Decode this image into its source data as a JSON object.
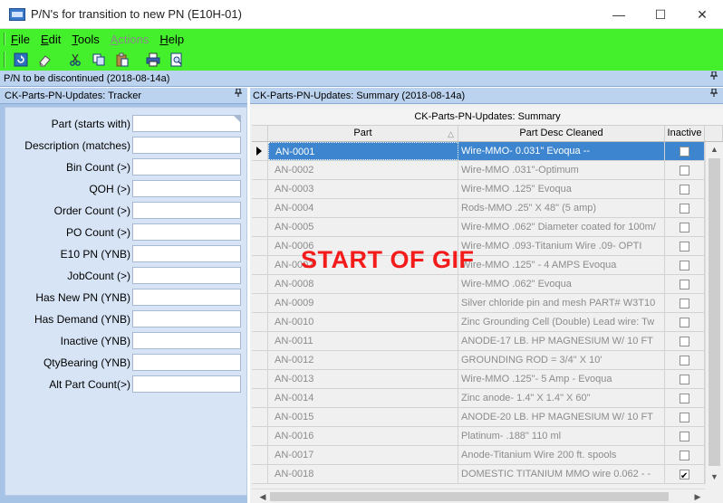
{
  "window": {
    "title": "P/N's for transition to new PN (E10H-01)",
    "minimize_glyph": "—",
    "maximize_glyph": "☐",
    "close_glyph": "✕"
  },
  "menu": {
    "file": {
      "accel": "F",
      "rest": "ile"
    },
    "edit": {
      "accel": "E",
      "rest": "dit"
    },
    "tools": {
      "accel": "T",
      "rest": "ools"
    },
    "actions": {
      "accel": "A",
      "rest": "ctions"
    },
    "help": {
      "accel": "H",
      "rest": "elp"
    }
  },
  "toolbar_icons": [
    "refresh-icon",
    "eraser-icon",
    "cut-icon",
    "copy-icon",
    "paste-icon",
    "print-icon",
    "print-preview-icon"
  ],
  "dock": {
    "top_title": "P/N to be discontinued (2018-08-14a)"
  },
  "tracker": {
    "title": "CK-Parts-PN-Updates: Tracker",
    "fields": [
      {
        "label": "Part (starts with)",
        "value": ""
      },
      {
        "label": "Description (matches)",
        "value": ""
      },
      {
        "label": "Bin Count (>)",
        "value": ""
      },
      {
        "label": "QOH (>)",
        "value": ""
      },
      {
        "label": "Order Count (>)",
        "value": ""
      },
      {
        "label": "PO Count (>)",
        "value": ""
      },
      {
        "label": "E10 PN (YNB)",
        "value": ""
      },
      {
        "label": "JobCount (>)",
        "value": ""
      },
      {
        "label": "Has New PN (YNB)",
        "value": ""
      },
      {
        "label": "Has Demand (YNB)",
        "value": ""
      },
      {
        "label": "Inactive (YNB)",
        "value": ""
      },
      {
        "label": "QtyBearing (YNB)",
        "value": ""
      },
      {
        "label": "Alt Part Count(>)",
        "value": ""
      }
    ]
  },
  "summary": {
    "title": "CK-Parts-PN-Updates: Summary (2018-08-14a)",
    "grid_title": "CK-Parts-PN-Updates: Summary",
    "columns": [
      "Part",
      "Part Desc Cleaned",
      "Inactive"
    ],
    "rows": [
      {
        "part": "AN-0001",
        "desc": "Wire-MMO- 0.031\" Evoqua --",
        "inactive": false,
        "selected": true
      },
      {
        "part": "AN-0002",
        "desc": "Wire-MMO .031\"-Optimum",
        "inactive": false
      },
      {
        "part": "AN-0003",
        "desc": "Wire-MMO .125\" Evoqua",
        "inactive": false
      },
      {
        "part": "AN-0004",
        "desc": "Rods-MMO .25\" X 48\" (5 amp)",
        "inactive": false
      },
      {
        "part": "AN-0005",
        "desc": "Wire-MMO .062\" Diameter coated for 100m/",
        "inactive": false
      },
      {
        "part": "AN-0006",
        "desc": "Wire-MMO .093-Titanium Wire .09- OPTI",
        "inactive": false
      },
      {
        "part": "AN-0007",
        "desc": "Wire-MMO .125\" - 4 AMPS Evoqua",
        "inactive": false
      },
      {
        "part": "AN-0008",
        "desc": "Wire-MMO .062\" Evoqua",
        "inactive": false
      },
      {
        "part": "AN-0009",
        "desc": "Silver chloride pin and mesh PART# W3T10",
        "inactive": false
      },
      {
        "part": "AN-0010",
        "desc": "Zinc Grounding Cell (Double) Lead wire: Tw",
        "inactive": false
      },
      {
        "part": "AN-0011",
        "desc": "ANODE-17 LB. HP MAGNESIUM W/ 10 FT",
        "inactive": false
      },
      {
        "part": "AN-0012",
        "desc": "GROUNDING ROD = 3/4\" X 10'",
        "inactive": false
      },
      {
        "part": "AN-0013",
        "desc": "Wire-MMO .125\"- 5 Amp - Evoqua",
        "inactive": false
      },
      {
        "part": "AN-0014",
        "desc": "Zinc anode- 1.4\" X 1.4\" X 60\"",
        "inactive": false
      },
      {
        "part": "AN-0015",
        "desc": "ANODE-20 LB. HP MAGNESIUM W/ 10 FT",
        "inactive": false
      },
      {
        "part": "AN-0016",
        "desc": "Platinum- .188\" 110 ml",
        "inactive": false
      },
      {
        "part": "AN-0017",
        "desc": "Anode-Titanium Wire 200 ft. spools",
        "inactive": false
      },
      {
        "part": "AN-0018",
        "desc": "DOMESTIC TITANIUM MMO wire 0.062 - -",
        "inactive": true
      }
    ]
  },
  "overlay_text": "START OF GIF",
  "pin_glyph": "📌",
  "colors": {
    "menubar": "#44f02c",
    "selection": "#3d86cf",
    "overlay": "#f41b1b",
    "dock": "#bcd3ef"
  }
}
